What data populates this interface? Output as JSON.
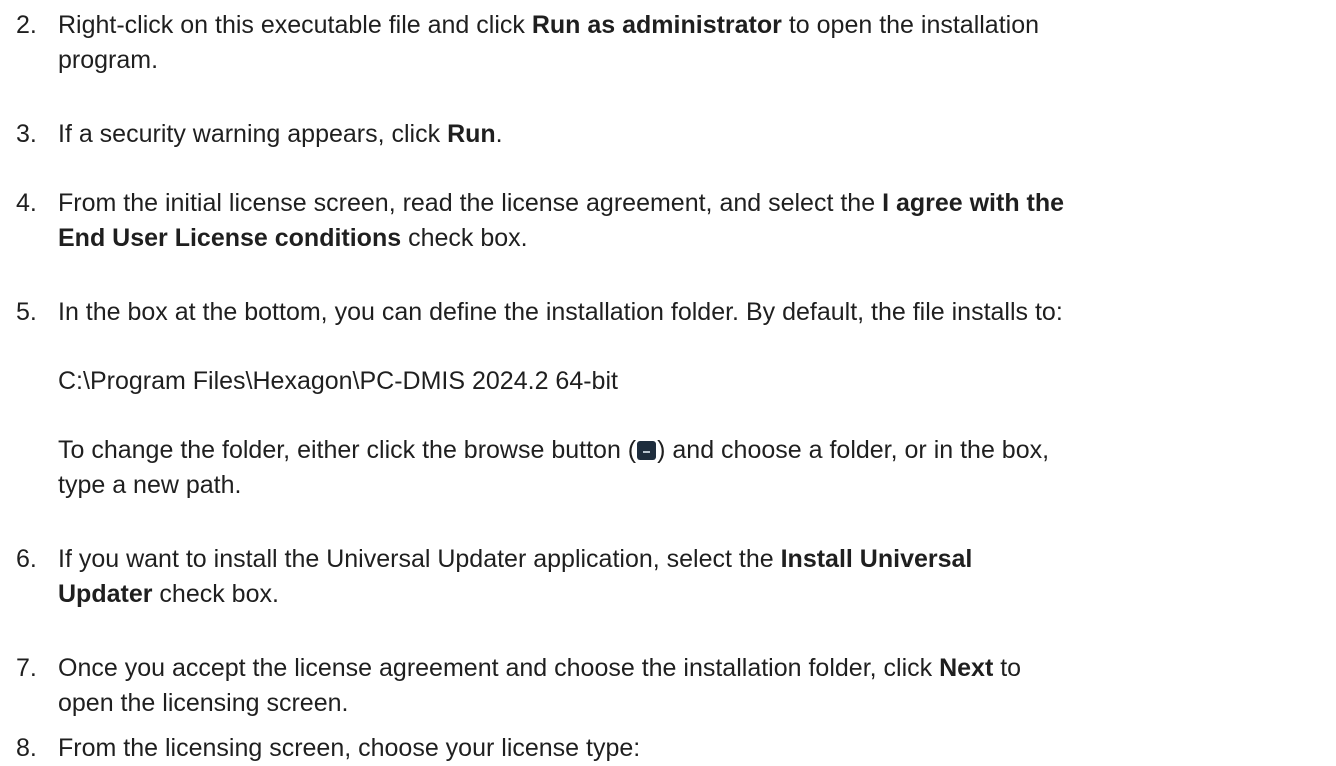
{
  "steps": [
    {
      "number": "2.",
      "parts": [
        "Right-click on this executable file and click ",
        "Run as administrator",
        " to open the installation",
        "program."
      ]
    },
    {
      "number": "3.",
      "parts": [
        "If a security warning appears, click ",
        "Run",
        "."
      ]
    },
    {
      "number": "4.",
      "parts": [
        "From the initial license screen, read the license agreement, and select the ",
        "I agree with the",
        "End User License conditions",
        " check box."
      ]
    },
    {
      "number": "5.",
      "parts": [
        "In the box at the bottom, you can define the installation folder. By default, the file installs to:"
      ],
      "path": "C:\\Program Files\\Hexagon\\PC-DMIS 2024.2 64-bit",
      "change": [
        "To change the folder, either click the browse button (",
        ") and choose a folder, or in the box,",
        "type a new path."
      ]
    },
    {
      "number": "6.",
      "parts": [
        "If you want to install the Universal Updater application, select the ",
        "Install Universal",
        "Updater",
        " check box."
      ]
    },
    {
      "number": "7.",
      "parts": [
        "Once you accept the license agreement and choose the installation folder, click ",
        "Next",
        " to",
        "open the licensing screen."
      ]
    },
    {
      "number": "8.",
      "parts": [
        "From the licensing screen, choose your license type:"
      ]
    }
  ]
}
